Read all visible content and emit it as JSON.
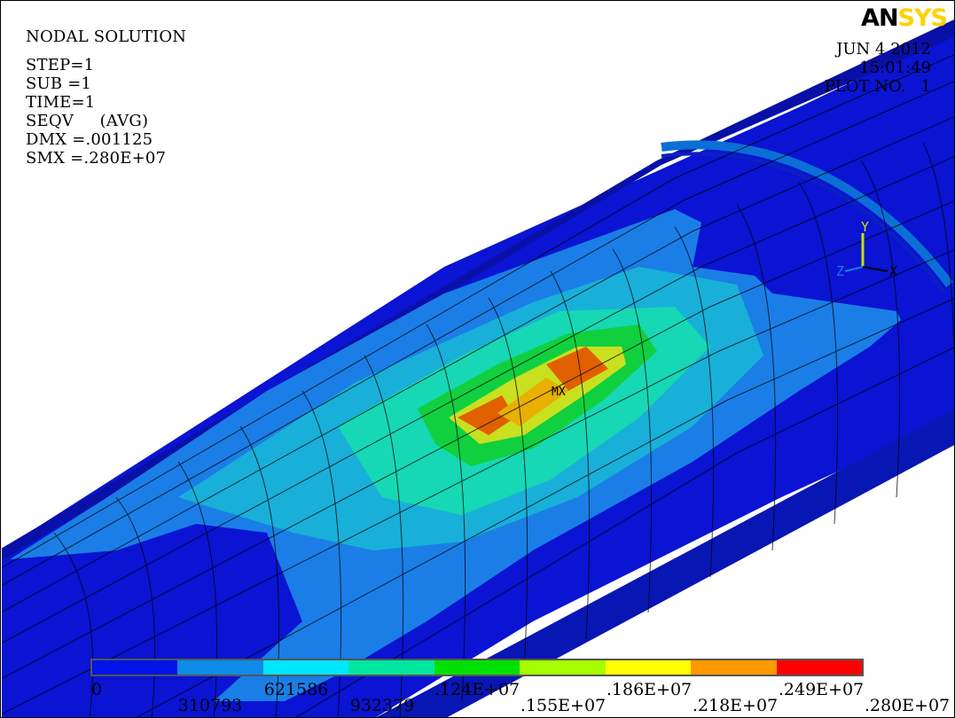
{
  "header": {
    "title": "NODAL SOLUTION",
    "step": "STEP=1",
    "sub": "SUB =1",
    "time": "TIME=1",
    "result": "SEQV     (AVG)",
    "dmx": "DMX =.001125",
    "smx": "SMX =.280E+07"
  },
  "logo": {
    "an": "AN",
    "sys": "SYS"
  },
  "stamp": {
    "date": "JUN 4 2012",
    "time": "15:01:49",
    "plot": "PLOT NO.   1"
  },
  "triad": {
    "y": "Y",
    "z": "Z",
    "x": "X"
  },
  "max_marker": "MX",
  "legend": {
    "colors": [
      "#0014e6",
      "#0d8ce8",
      "#00e6ff",
      "#00e6a0",
      "#00e000",
      "#a6ff00",
      "#ffff00",
      "#ff9900",
      "#ff0000"
    ],
    "labels_top": [
      "0",
      "621586",
      ".124E+07",
      ".186E+07",
      ".249E+07"
    ],
    "labels_bottom": [
      "310793",
      "932379",
      ".155E+07",
      ".218E+07",
      ".280E+07"
    ]
  }
}
